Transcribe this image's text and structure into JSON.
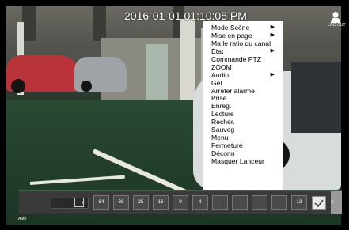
{
  "timestamp": "2016-01-01 01:10:05 PM",
  "user_label": "LOG OUT",
  "corner_label": "Auto",
  "context_menu": {
    "items": [
      {
        "label": "Mode Scène",
        "submenu": true
      },
      {
        "label": "Mise en page",
        "submenu": true
      },
      {
        "label": "Ma.le ratio du canal",
        "submenu": false
      },
      {
        "label": "État",
        "submenu": true
      },
      {
        "label": "Commande PTZ",
        "submenu": false
      },
      {
        "label": "ZOOM",
        "submenu": false
      },
      {
        "label": "Audio",
        "submenu": true
      },
      {
        "label": "Gel",
        "submenu": false
      },
      {
        "label": "Arrêter alarme",
        "submenu": false
      },
      {
        "label": "Prise",
        "submenu": false
      },
      {
        "label": "Enreg.",
        "submenu": false
      },
      {
        "label": "Lecture",
        "submenu": false
      },
      {
        "label": "Recher.",
        "submenu": false
      },
      {
        "label": "Sauveg",
        "submenu": false
      },
      {
        "label": "Menu",
        "submenu": false
      },
      {
        "label": "Fermeture",
        "submenu": false
      },
      {
        "label": "Déconn",
        "submenu": false
      },
      {
        "label": "Masquer Lanceur",
        "submenu": false
      }
    ],
    "submenu_arrow": "▶"
  },
  "toolbar": {
    "layout_buttons": [
      "64",
      "36",
      "25",
      "16",
      "9",
      "4",
      "",
      "",
      "",
      "",
      "13"
    ],
    "next_arrow": "»"
  }
}
